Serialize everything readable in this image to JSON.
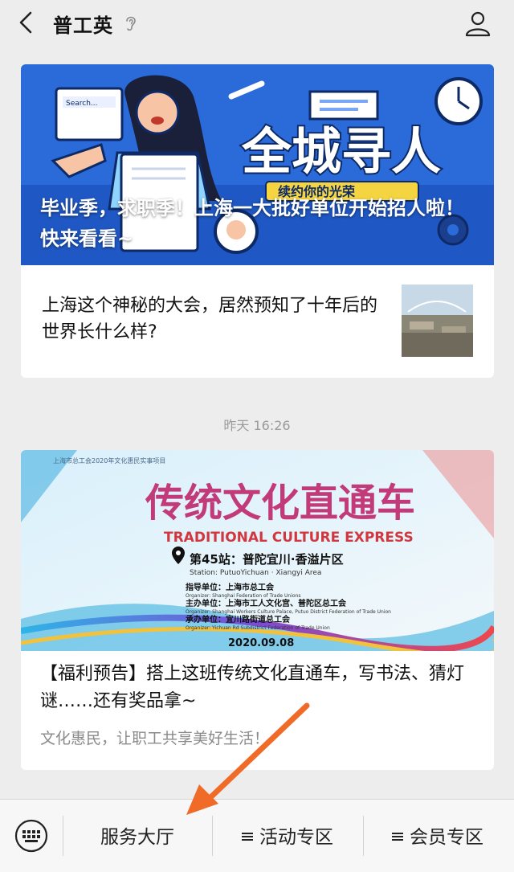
{
  "header": {
    "title": "普工英",
    "icons": [
      "back-icon",
      "ear-icon",
      "profile-icon"
    ]
  },
  "article1": {
    "banner_headline": "全城寻人",
    "banner_sub": "续约你的光荣",
    "banner_search_text": "Search...",
    "caption": "毕业季，求职季！上海一大批好单位开始招人啦！快来看看~"
  },
  "article2": {
    "title": "上海这个神秘的大会，居然预知了十年后的世界长什么样?"
  },
  "timestamp": "昨天 16:26",
  "article3": {
    "banner": {
      "top_text": "上海市总工会2020年文化惠民实事项目",
      "title_cn": "传统文化直通车",
      "title_en": "TRADITIONAL CULTURE EXPRESS",
      "station": "第45站：普陀宜川·香溢片区",
      "station_en": "Station: PutuoYichuan · Xiangyi Area",
      "guide_label": "指导单位：上海市总工会",
      "guide_en": "Organizer: Shanghai Federation of Trade Unions",
      "host_label": "主办单位：上海市工人文化宫、普陀区总工会",
      "host_en": "Organizer: Shanghai Workers Culture Palace, Putuo District Federation of Trade Union",
      "exec_label": "承办单位：宜川路街道总工会",
      "exec_en": "Organizer: Yichuan Rd Subdistrict Federation of Trade Union",
      "date": "2020.09.08"
    },
    "title": "【福利预告】搭上这班传统文化直通车，写书法、猜灯谜……还有奖品拿~",
    "digest": "文化惠民，让职工共享美好生活！"
  },
  "menu": {
    "items": [
      "服务大厅",
      "活动专区",
      "会员专区"
    ],
    "icons": [
      "keyboard-icon",
      "hamburger-icon"
    ]
  },
  "colors": {
    "accent_arrow": "#f06a28",
    "banner1_bg": "#2a6ad8",
    "banner2_bg": "#eaf5fb"
  }
}
